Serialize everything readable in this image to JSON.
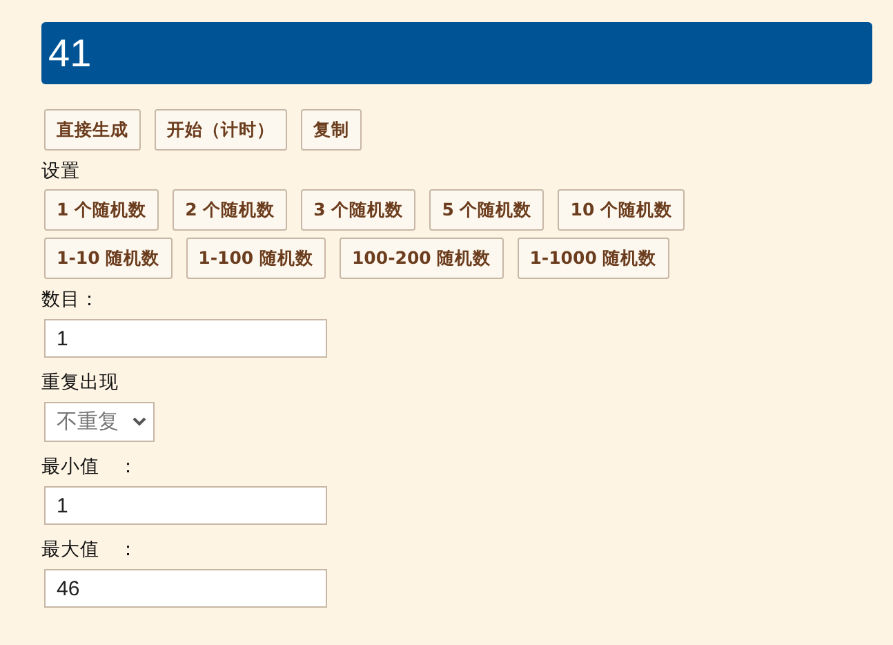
{
  "result": "41",
  "actions": [
    "直接生成",
    "开始（计时）",
    "复制"
  ],
  "settings_title": "设置",
  "preset_rows": [
    [
      "1 个随机数",
      "2 个随机数",
      "3 个随机数",
      "5 个随机数",
      "10 个随机数"
    ],
    [
      "1-10 随机数",
      "1-100 随机数",
      "100-200 随机数",
      "1-1000 随机数"
    ]
  ],
  "fields": [
    {
      "kind": "input",
      "label": "数目：",
      "value": "1"
    },
    {
      "kind": "select",
      "label": "重复出现",
      "value": "不重复"
    },
    {
      "kind": "input",
      "label": "最小值　：",
      "value": "1"
    },
    {
      "kind": "input",
      "label": "最大值　：",
      "value": "46"
    }
  ]
}
